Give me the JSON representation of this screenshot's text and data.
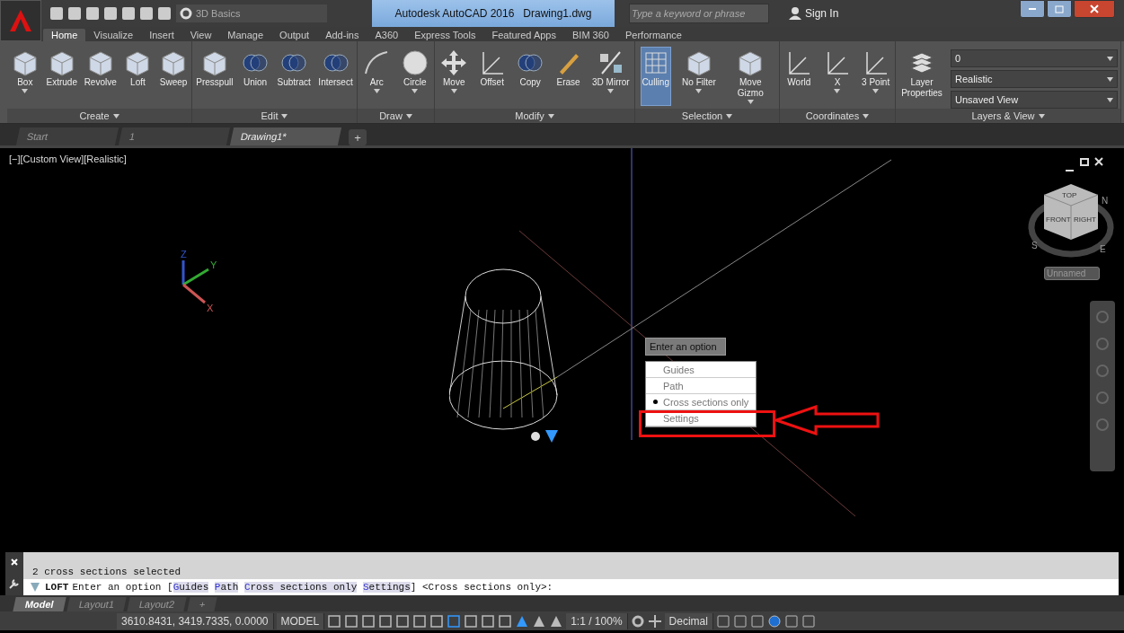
{
  "title_bar": {
    "workspace": "3D Basics",
    "title": "Autodesk AutoCAD 2016   Drawing1.dwg",
    "search": {
      "placeholder": "Type a keyword or phrase"
    },
    "sign_in": "Sign In"
  },
  "ribbon_tabs": [
    {
      "label": "Home",
      "selected": true
    },
    {
      "label": "Visualize",
      "selected": false
    },
    {
      "label": "Insert",
      "selected": false
    },
    {
      "label": "View",
      "selected": false
    },
    {
      "label": "Manage",
      "selected": false
    },
    {
      "label": "Output",
      "selected": false
    },
    {
      "label": "Add-ins",
      "selected": false
    },
    {
      "label": "A360",
      "selected": false
    },
    {
      "label": "Express Tools",
      "selected": false
    },
    {
      "label": "Featured Apps",
      "selected": false
    },
    {
      "label": "BIM 360",
      "selected": false
    },
    {
      "label": "Performance",
      "selected": false
    }
  ],
  "ribbon_panels": [
    {
      "title": "Create",
      "tools": [
        {
          "label": "Box",
          "dropdown": true,
          "active": false
        },
        {
          "label": "Extrude",
          "dropdown": false,
          "active": false
        },
        {
          "label": "Revolve",
          "dropdown": false,
          "active": false
        },
        {
          "label": "Loft",
          "dropdown": false,
          "active": false
        },
        {
          "label": "Sweep",
          "dropdown": false,
          "active": false
        }
      ]
    },
    {
      "title": "Edit",
      "tools": [
        {
          "label": "Presspull",
          "dropdown": false,
          "active": false
        },
        {
          "label": "Union",
          "dropdown": false,
          "active": false
        },
        {
          "label": "Subtract",
          "dropdown": false,
          "active": false
        },
        {
          "label": "Intersect",
          "dropdown": false,
          "active": false
        }
      ]
    },
    {
      "title": "Draw",
      "tools": [
        {
          "label": "Arc",
          "dropdown": true,
          "active": false
        },
        {
          "label": "Circle",
          "dropdown": true,
          "active": false
        }
      ]
    },
    {
      "title": "Modify",
      "tools": [
        {
          "label": "Move",
          "dropdown": true,
          "active": false
        },
        {
          "label": "Offset",
          "dropdown": false,
          "active": false
        },
        {
          "label": "Copy",
          "dropdown": false,
          "active": false
        },
        {
          "label": "Erase",
          "dropdown": false,
          "active": false
        },
        {
          "label": "3D Mirror",
          "dropdown": true,
          "active": false
        }
      ]
    },
    {
      "title": "Selection",
      "tools": [
        {
          "label": "Culling",
          "dropdown": false,
          "active": true
        },
        {
          "label": "No Filter",
          "dropdown": true,
          "active": false
        },
        {
          "label": "Move Gizmo",
          "dropdown": true,
          "active": false
        }
      ]
    },
    {
      "title": "Coordinates",
      "tools": [
        {
          "label": "World",
          "dropdown": false,
          "active": false
        },
        {
          "label": "X",
          "dropdown": true,
          "active": false
        },
        {
          "label": "3 Point",
          "dropdown": true,
          "active": false
        }
      ]
    },
    {
      "title": "Layers & View",
      "tools": [
        {
          "label": "Layer Properties",
          "dropdown": false,
          "active": false
        }
      ],
      "dropdowns": [
        "0",
        "Realistic",
        "Unsaved View"
      ]
    }
  ],
  "doc_tabs": [
    {
      "label": "Start",
      "selected": false
    },
    {
      "label": "1",
      "selected": false
    },
    {
      "label": "Drawing1*",
      "selected": true
    }
  ],
  "new_tab": "+",
  "viewport": {
    "label": "[−][Custom View][Realistic]",
    "viewcube": {
      "faces": [
        "TOP",
        "FRONT",
        "RIGHT"
      ],
      "compass": [
        "N",
        "S",
        "E"
      ]
    },
    "view_name": "Unnamed",
    "ucs": [
      "Z",
      "Y",
      "X"
    ]
  },
  "option_menu": {
    "title": "Enter an option",
    "items": [
      {
        "label": "Guides",
        "selected": false
      },
      {
        "label": "Path",
        "selected": false
      },
      {
        "label": "Cross sections only",
        "selected": true
      },
      {
        "label": "Settings",
        "selected": false
      }
    ]
  },
  "command_line": {
    "history": "2 cross sections selected",
    "command": "LOFT",
    "prompt": "Enter an option [",
    "options": [
      "Guides",
      "Path",
      "Cross sections only",
      "Settings"
    ],
    "suffix": "] <Cross sections only>:"
  },
  "layout_tabs": [
    {
      "label": "Model",
      "selected": true
    },
    {
      "label": "Layout1",
      "selected": false
    },
    {
      "label": "Layout2",
      "selected": false
    }
  ],
  "new_layout": "+",
  "status_bar": {
    "coordinates": "3610.8431, 3419.7335, 0.0000",
    "space": "MODEL",
    "scale": "1:1 / 100%",
    "units": "Decimal"
  }
}
